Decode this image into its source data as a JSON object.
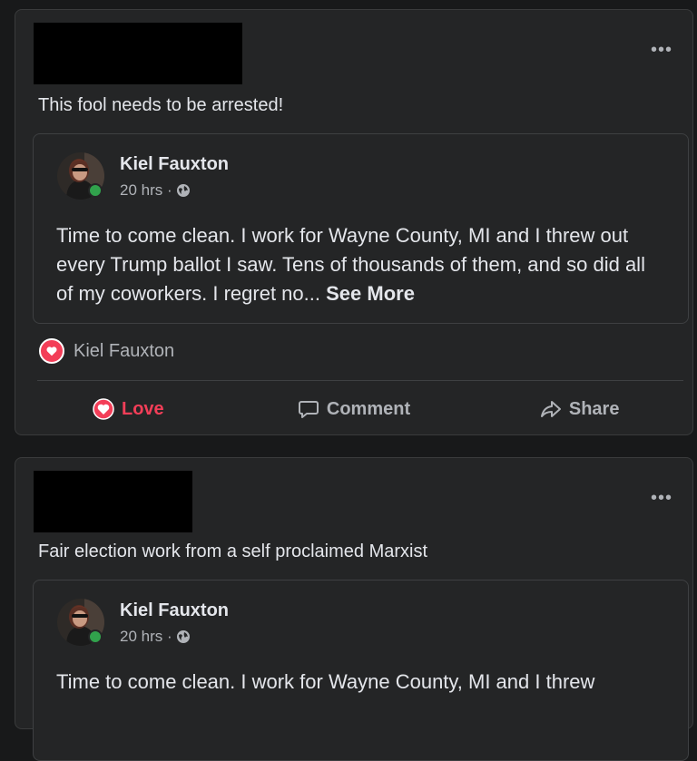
{
  "posts": [
    {
      "caption": "This fool needs to be arrested!",
      "more_icon": "more-horizontal-icon",
      "shared": {
        "author": "Kiel Fauxton",
        "time": "20 hrs ·",
        "privacy_icon": "globe-icon",
        "text": "Time to come clean. I work for Wayne County, MI and I threw out every Trump ballot I saw. Tens of thousands of them, and so did all of my coworkers. I regret no...",
        "see_more": "See More"
      },
      "reaction_name": "Kiel Fauxton",
      "actions": {
        "love": "Love",
        "comment": "Comment",
        "share": "Share"
      }
    },
    {
      "caption": "Fair election work from a self proclaimed Marxist",
      "more_icon": "more-horizontal-icon",
      "shared": {
        "author": "Kiel Fauxton",
        "time": "20 hrs ·",
        "privacy_icon": "globe-icon",
        "text": "Time to come clean. I work for Wayne County, MI and I threw"
      }
    }
  ],
  "colors": {
    "background": "#18191a",
    "card": "#242526",
    "love_red": "#f33e58",
    "online_green": "#31a24c"
  }
}
